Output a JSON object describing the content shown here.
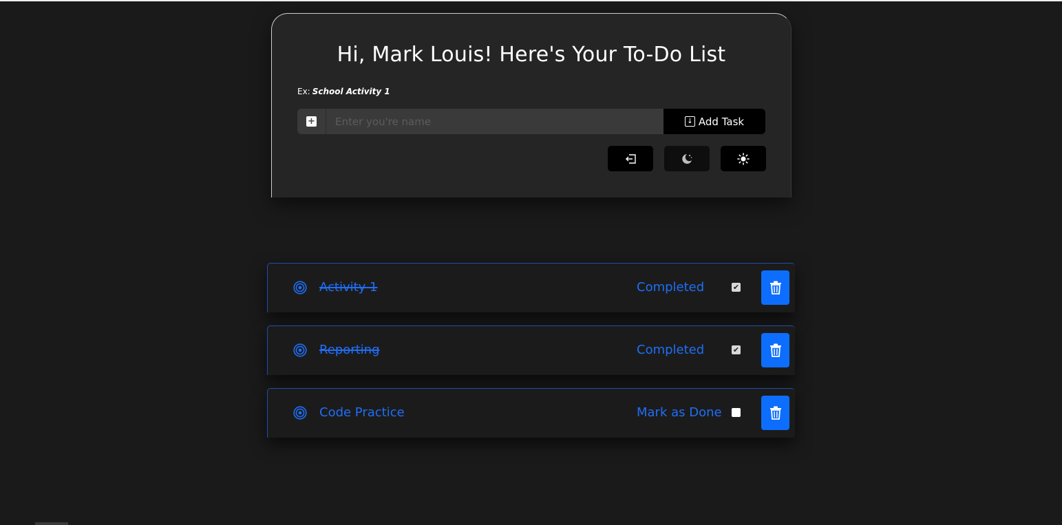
{
  "header": {
    "title": "Hi, Mark Louis! Here's Your To-Do List",
    "hint_label": "Ex:",
    "hint_value": "School Activity 1"
  },
  "input": {
    "placeholder": "Enter you're name",
    "value": "",
    "addon_icon": "plus-square-icon"
  },
  "add_button": {
    "label": "Add Task",
    "icon": "download-box-icon"
  },
  "toolbar": {
    "buttons": [
      {
        "name": "logout",
        "icon": "logout-icon"
      },
      {
        "name": "dark-mode",
        "icon": "moon-stars-icon"
      },
      {
        "name": "light-mode",
        "icon": "sun-icon"
      }
    ]
  },
  "tasks": [
    {
      "name": "Activity 1",
      "status": "Completed",
      "checked": true
    },
    {
      "name": "Reporting",
      "status": "Completed",
      "checked": true
    },
    {
      "name": "Code Practice",
      "status": "Mark as Done",
      "checked": false
    }
  ],
  "colors": {
    "background": "#1b1a1b",
    "card": "#252525",
    "accent_blue": "#1e6ff6",
    "delete_blue": "#0d6efd"
  }
}
